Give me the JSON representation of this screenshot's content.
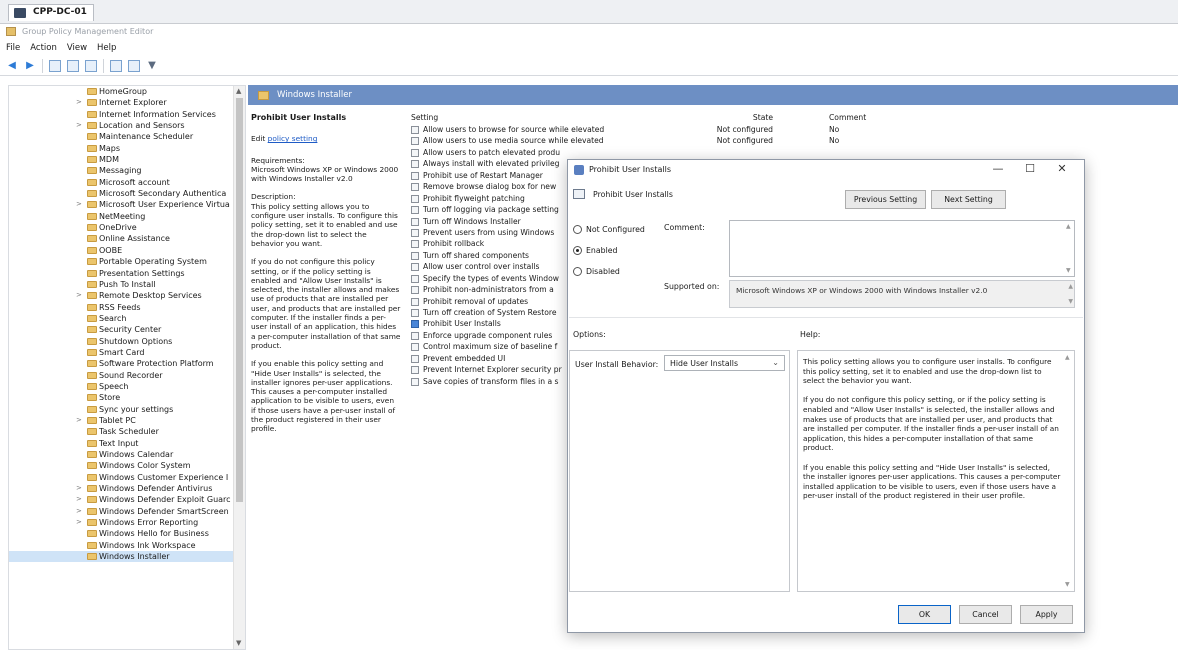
{
  "window": {
    "tab_title": "CPP-DC-01"
  },
  "app": {
    "title": "Group Policy Management Editor"
  },
  "menu": {
    "items": [
      "File",
      "Action",
      "View",
      "Help"
    ]
  },
  "toolbar": {
    "icons": [
      "back-icon",
      "forward-icon",
      "up-icon",
      "show-hide-tree-icon",
      "export-icon",
      "help-icon",
      "properties-icon",
      "filter-icon"
    ]
  },
  "tree": {
    "items": [
      {
        "label": "HomeGroup",
        "expand": ""
      },
      {
        "label": "Internet Explorer",
        "expand": ">"
      },
      {
        "label": "Internet Information Services",
        "expand": ""
      },
      {
        "label": "Location and Sensors",
        "expand": ">"
      },
      {
        "label": "Maintenance Scheduler",
        "expand": ""
      },
      {
        "label": "Maps",
        "expand": ""
      },
      {
        "label": "MDM",
        "expand": ""
      },
      {
        "label": "Messaging",
        "expand": ""
      },
      {
        "label": "Microsoft account",
        "expand": ""
      },
      {
        "label": "Microsoft Secondary Authentica",
        "expand": ""
      },
      {
        "label": "Microsoft User Experience Virtua",
        "expand": ">"
      },
      {
        "label": "NetMeeting",
        "expand": ""
      },
      {
        "label": "OneDrive",
        "expand": ""
      },
      {
        "label": "Online Assistance",
        "expand": ""
      },
      {
        "label": "OOBE",
        "expand": ""
      },
      {
        "label": "Portable Operating System",
        "expand": ""
      },
      {
        "label": "Presentation Settings",
        "expand": ""
      },
      {
        "label": "Push To Install",
        "expand": ""
      },
      {
        "label": "Remote Desktop Services",
        "expand": ">"
      },
      {
        "label": "RSS Feeds",
        "expand": ""
      },
      {
        "label": "Search",
        "expand": ""
      },
      {
        "label": "Security Center",
        "expand": ""
      },
      {
        "label": "Shutdown Options",
        "expand": ""
      },
      {
        "label": "Smart Card",
        "expand": ""
      },
      {
        "label": "Software Protection Platform",
        "expand": ""
      },
      {
        "label": "Sound Recorder",
        "expand": ""
      },
      {
        "label": "Speech",
        "expand": ""
      },
      {
        "label": "Store",
        "expand": ""
      },
      {
        "label": "Sync your settings",
        "expand": ""
      },
      {
        "label": "Tablet PC",
        "expand": ">"
      },
      {
        "label": "Task Scheduler",
        "expand": ""
      },
      {
        "label": "Text Input",
        "expand": ""
      },
      {
        "label": "Windows Calendar",
        "expand": ""
      },
      {
        "label": "Windows Color System",
        "expand": ""
      },
      {
        "label": "Windows Customer Experience I",
        "expand": ""
      },
      {
        "label": "Windows Defender Antivirus",
        "expand": ">"
      },
      {
        "label": "Windows Defender Exploit Guarc",
        "expand": ">"
      },
      {
        "label": "Windows Defender SmartScreen",
        "expand": ">"
      },
      {
        "label": "Windows Error Reporting",
        "expand": ">"
      },
      {
        "label": "Windows Hello for Business",
        "expand": ""
      },
      {
        "label": "Windows Ink Workspace",
        "expand": ""
      },
      {
        "label": "Windows Installer",
        "expand": "",
        "selected": true
      }
    ]
  },
  "right_pane": {
    "header": "Windows Installer",
    "description": {
      "title": "Prohibit User Installs",
      "edit_prefix": "Edit ",
      "edit_link": "policy setting",
      "paragraphs": [
        "Requirements:\nMicrosoft Windows XP or Windows 2000 with Windows Installer v2.0",
        "Description:\nThis policy setting allows you to configure user installs. To configure this policy setting, set it to enabled and use the drop-down list to select the behavior you want.",
        "If you do not configure this policy setting, or if the policy setting is enabled and \"Allow User Installs\" is selected, the installer allows and makes use of products that are installed per user, and products that are installed per computer. If the installer finds a per-user install of an application, this hides a per-computer installation of that same product.",
        "If you enable this policy setting and \"Hide User Installs\" is selected, the installer ignores per-user applications. This causes a per-computer installed application to be visible to users, even if those users have a per-user install of the product registered in their user profile."
      ]
    },
    "columns": {
      "setting": "Setting",
      "state": "State",
      "comment": "Comment"
    },
    "settings": [
      {
        "name": "Allow users to browse for source while elevated",
        "state": "Not configured",
        "comment": "No"
      },
      {
        "name": "Allow users to use media source while elevated",
        "state": "Not configured",
        "comment": "No"
      },
      {
        "name": "Allow users to patch elevated produ",
        "state": "",
        "comment": ""
      },
      {
        "name": "Always install with elevated privileg",
        "state": "",
        "comment": ""
      },
      {
        "name": "Prohibit use of Restart Manager",
        "state": "",
        "comment": ""
      },
      {
        "name": "Remove browse dialog box for new",
        "state": "",
        "comment": ""
      },
      {
        "name": "Prohibit flyweight patching",
        "state": "",
        "comment": ""
      },
      {
        "name": "Turn off logging via package setting",
        "state": "",
        "comment": ""
      },
      {
        "name": "Turn off Windows Installer",
        "state": "",
        "comment": ""
      },
      {
        "name": "Prevent users from using Windows",
        "state": "",
        "comment": ""
      },
      {
        "name": "Prohibit rollback",
        "state": "",
        "comment": ""
      },
      {
        "name": "Turn off shared components",
        "state": "",
        "comment": ""
      },
      {
        "name": "Allow user control over installs",
        "state": "",
        "comment": ""
      },
      {
        "name": "Specify the types of events Window",
        "state": "",
        "comment": ""
      },
      {
        "name": "Prohibit non-administrators from a",
        "state": "",
        "comment": ""
      },
      {
        "name": "Prohibit removal of updates",
        "state": "",
        "comment": ""
      },
      {
        "name": "Turn off creation of System Restore",
        "state": "",
        "comment": ""
      },
      {
        "name": "Prohibit User Installs",
        "state": "",
        "comment": "",
        "highlight": true
      },
      {
        "name": "Enforce upgrade component rules",
        "state": "",
        "comment": ""
      },
      {
        "name": "Control maximum size of baseline f",
        "state": "",
        "comment": ""
      },
      {
        "name": "Prevent embedded UI",
        "state": "",
        "comment": ""
      },
      {
        "name": "Prevent Internet Explorer security pr",
        "state": "",
        "comment": ""
      },
      {
        "name": "Save copies of transform files in a s",
        "state": "",
        "comment": ""
      }
    ]
  },
  "dialog": {
    "title": "Prohibit User Installs",
    "heading": "Prohibit User Installs",
    "previous_button": "Previous Setting",
    "next_button": "Next Setting",
    "radio_not_configured": "Not Configured",
    "radio_enabled": "Enabled",
    "radio_disabled": "Disabled",
    "selected_radio": "Enabled",
    "comment_label": "Comment:",
    "supported_label": "Supported on:",
    "supported_value": "Microsoft Windows XP or Windows 2000 with Windows Installer v2.0",
    "options_label": "Options:",
    "help_label": "Help:",
    "behavior_label": "User Install Behavior:",
    "behavior_value": "Hide User Installs",
    "help_paragraphs": [
      "This policy setting allows you to configure user installs. To configure this policy setting, set it to enabled and use the drop-down list to select the behavior you want.",
      "If you do not configure this policy setting, or if the policy setting is enabled and \"Allow User Installs\" is selected, the installer allows and makes use of products that are installed per user, and products that are installed per computer. If the installer finds a per-user install of an application, this hides a per-computer installation of that same product.",
      "If you enable this policy setting and \"Hide User Installs\" is selected, the installer ignores per-user applications. This causes a per-computer installed application to be visible to users, even if those users have a per-user install of the product registered in their user profile."
    ],
    "ok_button": "OK",
    "cancel_button": "Cancel",
    "apply_button": "Apply"
  }
}
